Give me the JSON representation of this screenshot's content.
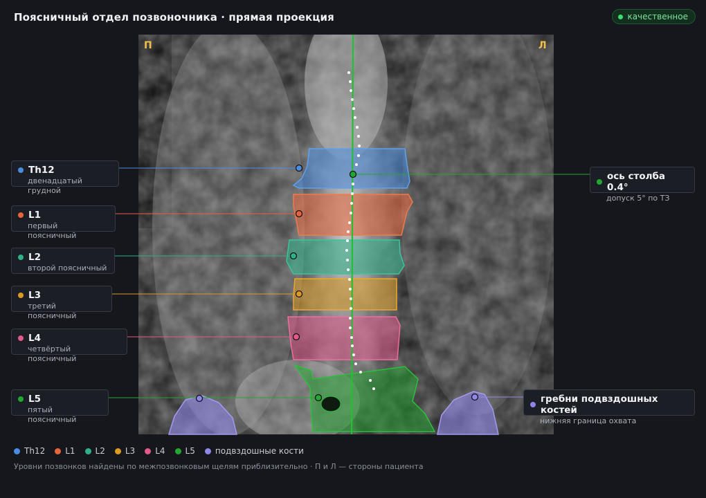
{
  "header": {
    "title": "Поясничный отдел позвоночника · прямая проекция",
    "badge": "качественное",
    "badge_color": "#3ddc6e"
  },
  "image": {
    "side_right": "П",
    "side_left": "Л"
  },
  "vertebrae": [
    {
      "id": "th12",
      "name": "Th12",
      "desc": "двенадцатый грудной",
      "color": "#4a8de0"
    },
    {
      "id": "l1",
      "name": "L1",
      "desc": "первый поясничный",
      "color": "#e8643a"
    },
    {
      "id": "l2",
      "name": "L2",
      "desc": "второй поясничный",
      "color": "#2fb08a"
    },
    {
      "id": "l3",
      "name": "L3",
      "desc": "третий поясничный",
      "color": "#dd9a22"
    },
    {
      "id": "l4",
      "name": "L4",
      "desc": "четвёртый поясничный",
      "color": "#e05a8a"
    },
    {
      "id": "l5",
      "name": "L5",
      "desc": "пятый поясничный",
      "color": "#22a830"
    }
  ],
  "axis": {
    "label": "ось столба 0.4°",
    "desc": "допуск 5° по ТЗ",
    "color": "#22a830"
  },
  "iliac": {
    "label": "гребни подвздошных костей",
    "desc": "нижняя граница охвата",
    "color": "#8f86e8"
  },
  "legend": [
    {
      "label": "Th12",
      "color": "#4a8de0"
    },
    {
      "label": "L1",
      "color": "#e8643a"
    },
    {
      "label": "L2",
      "color": "#2fb08a"
    },
    {
      "label": "L3",
      "color": "#dd9a22"
    },
    {
      "label": "L4",
      "color": "#e05a8a"
    },
    {
      "label": "L5",
      "color": "#22a830"
    },
    {
      "label": "подвздошные кости",
      "color": "#8f86e8"
    }
  ],
  "footnote": "Уровни позвонков найдены по межпозвонковым щелям приблизительно · П и Л — стороны пациента"
}
